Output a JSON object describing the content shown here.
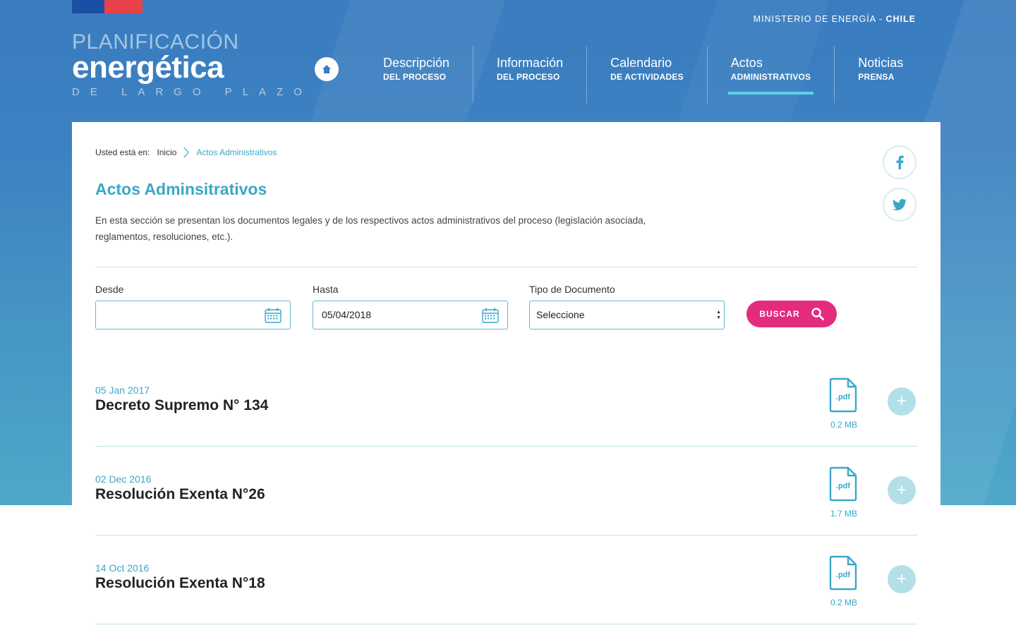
{
  "header": {
    "logo": {
      "line1": "PLANIFICACIÓN",
      "line2": "energética",
      "line3": "DE LARGO PLAZO"
    },
    "ministry_prefix": "MINISTERIO DE ENERGÍA - ",
    "ministry_country": "CHILE",
    "home_icon": "home-icon",
    "nav": [
      {
        "title": "Descripción",
        "subtitle": "DEL PROCESO",
        "active": false
      },
      {
        "title": "Información",
        "subtitle": "DEL PROCESO",
        "active": false
      },
      {
        "title": "Calendario",
        "subtitle": "DE ACTIVIDADES",
        "active": false
      },
      {
        "title": "Actos",
        "subtitle": "ADMINISTRATIVOS",
        "active": true
      },
      {
        "title": "Noticias",
        "subtitle": "PRENSA",
        "active": false
      }
    ]
  },
  "breadcrumb": {
    "prefix": "Usted está en:",
    "home": "Inicio",
    "current": "Actos Administrativos"
  },
  "social": {
    "facebook": "facebook-icon",
    "twitter": "twitter-icon"
  },
  "page": {
    "title": "Actos Adminsitrativos",
    "intro": "En esta sección se presentan los documentos legales y de los respectivos actos administrativos del proceso (legislación asociada, reglamentos, resoluciones, etc.)."
  },
  "filters": {
    "desde_label": "Desde",
    "desde_value": "",
    "hasta_label": "Hasta",
    "hasta_value": "05/04/2018",
    "tipo_label": "Tipo de Documento",
    "tipo_value": "Seleccione",
    "search_label": "BUSCAR"
  },
  "documents": [
    {
      "date": "05 Jan 2017",
      "name": "Decreto Supremo N° 134",
      "size": "0.2 MB",
      "file_badge": ".pdf"
    },
    {
      "date": "02 Dec 2016",
      "name": "Resolución Exenta N°26",
      "size": "1.7 MB",
      "file_badge": ".pdf"
    },
    {
      "date": "14 Oct 2016",
      "name": "Resolución Exenta N°18",
      "size": "0.2 MB",
      "file_badge": ".pdf"
    }
  ],
  "colors": {
    "accent": "#3aa7c8",
    "button": "#e42c7d",
    "nav_underline": "#5fd0e6"
  }
}
